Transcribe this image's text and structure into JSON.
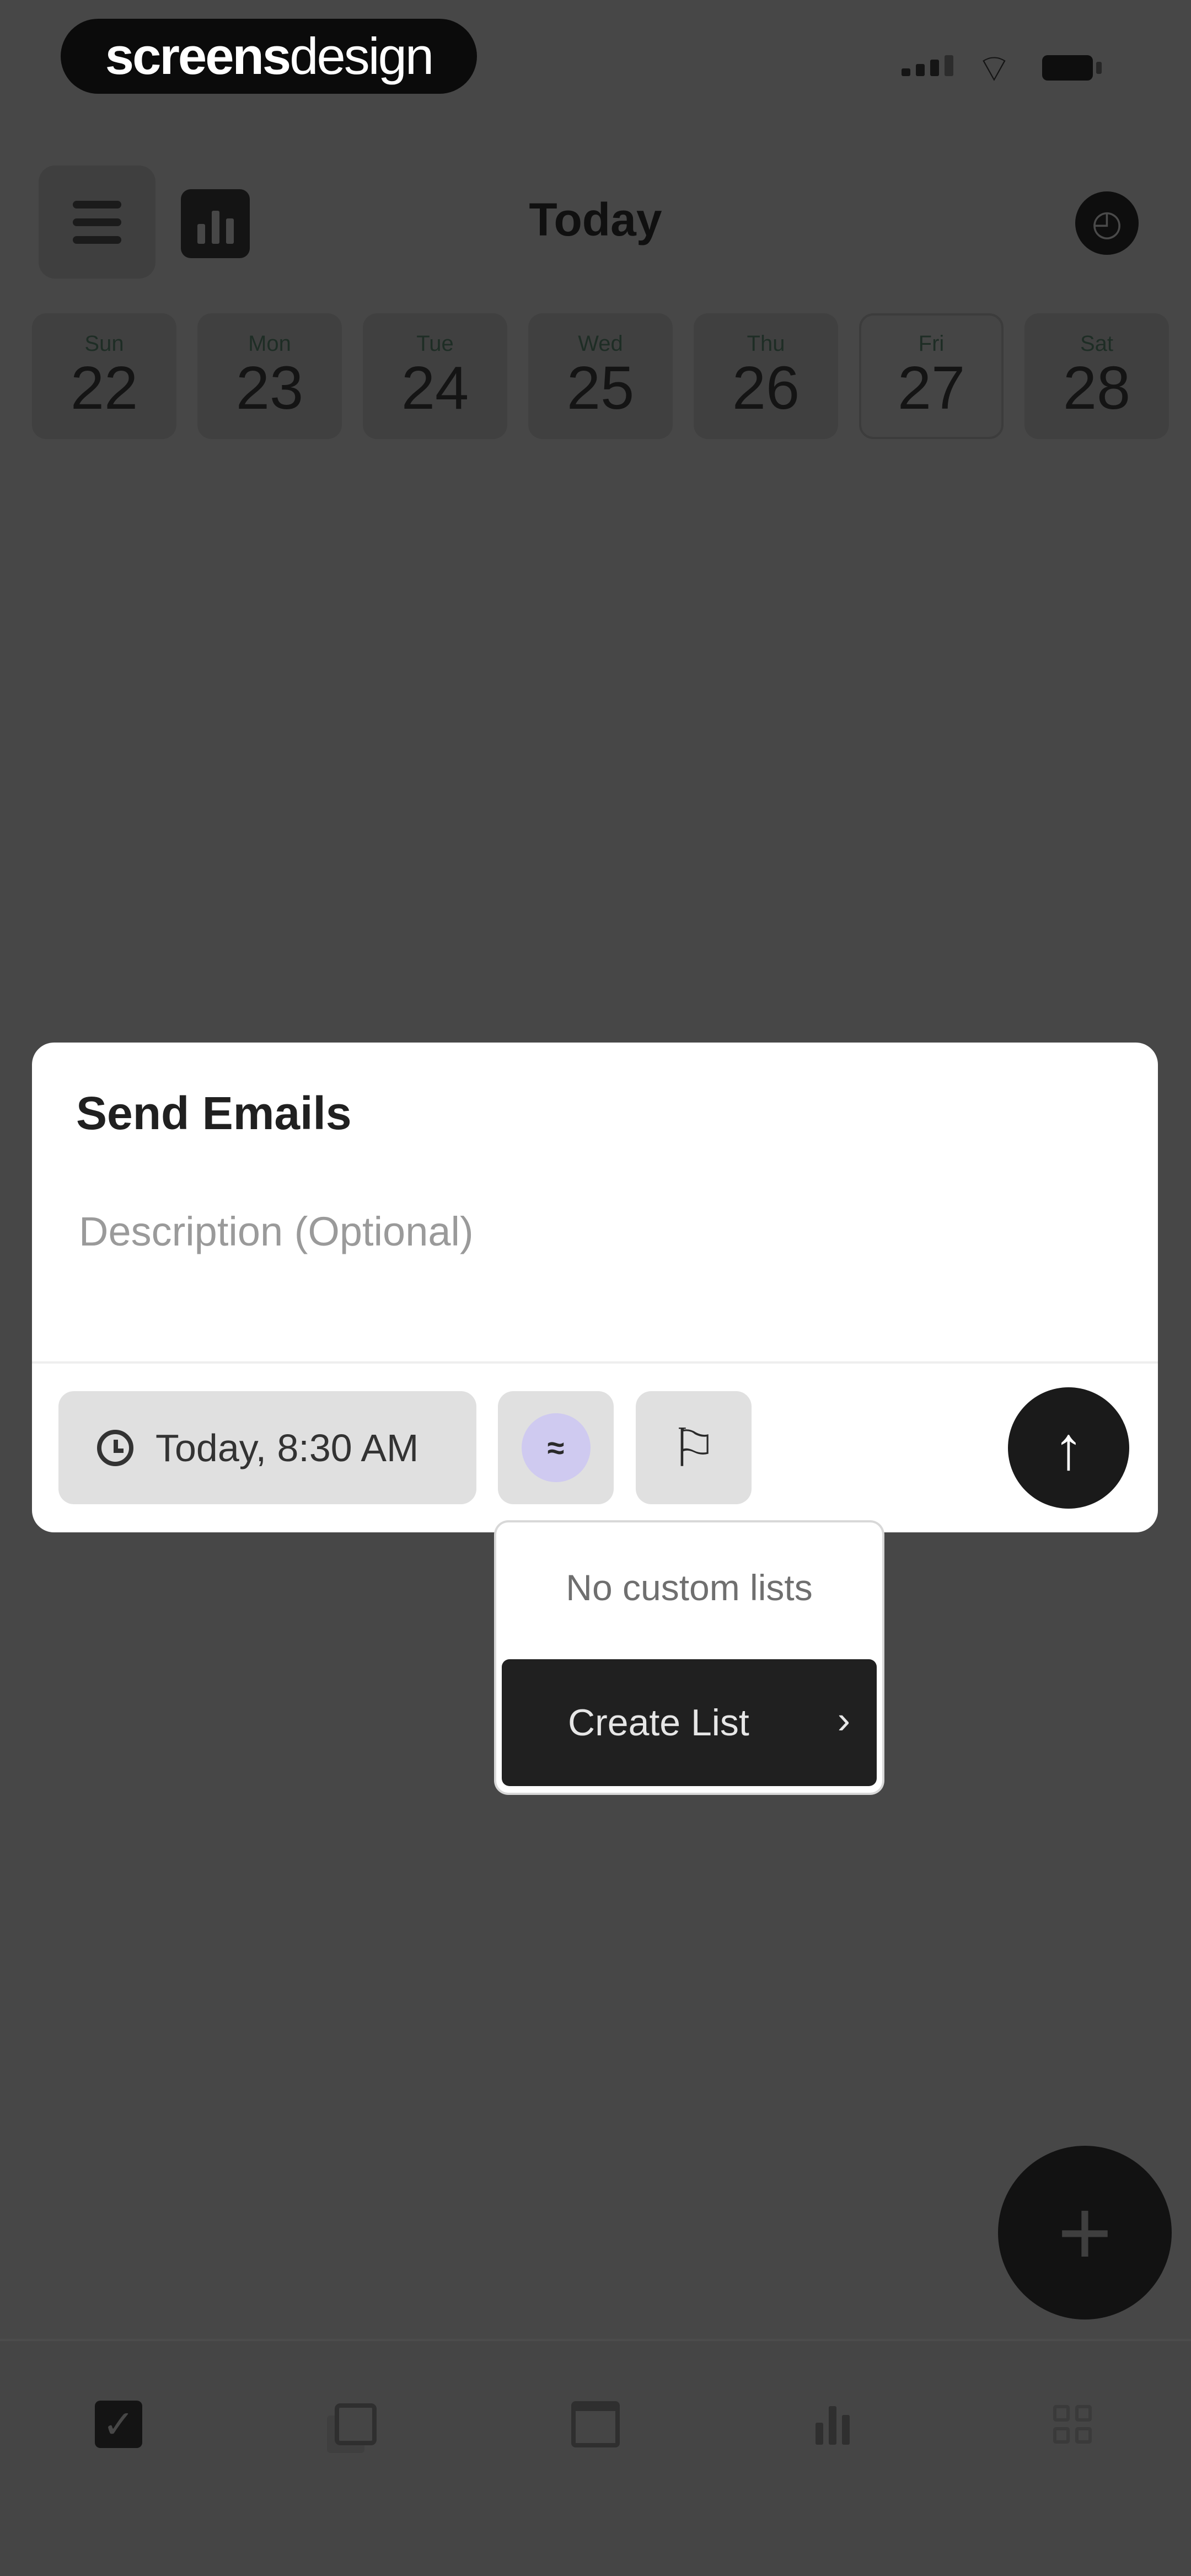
{
  "status_bar": {
    "brand_part1": "screens",
    "brand_part2": "design"
  },
  "header": {
    "title": "Today"
  },
  "days": [
    {
      "name": "Sun",
      "num": "22"
    },
    {
      "name": "Mon",
      "num": "23"
    },
    {
      "name": "Tue",
      "num": "24"
    },
    {
      "name": "Wed",
      "num": "25"
    },
    {
      "name": "Thu",
      "num": "26"
    },
    {
      "name": "Fri",
      "num": "27",
      "selected": true
    },
    {
      "name": "Sat",
      "num": "28"
    }
  ],
  "task_card": {
    "title": "Send Emails",
    "description_placeholder": "Description (Optional)",
    "time": "Today, 8:30 AM"
  },
  "list_dropdown": {
    "empty_text": "No custom lists",
    "create_label": "Create List"
  },
  "colors": {
    "overlay": "#474747",
    "card": "#ffffff",
    "accent_list": "#cfcaf0",
    "dark": "#1a1a1a"
  },
  "icons": {
    "menu": "menu-icon",
    "stats": "bar-chart-icon",
    "timer": "stopwatch-icon",
    "clock": "alarm-clock-icon",
    "list": "list-icon",
    "flag": "flag-icon",
    "send": "arrow-up-icon",
    "add": "plus-icon",
    "tabs": [
      "checkbox-icon",
      "copy-icon",
      "calendar-icon",
      "bars-icon",
      "grid-icon"
    ]
  }
}
